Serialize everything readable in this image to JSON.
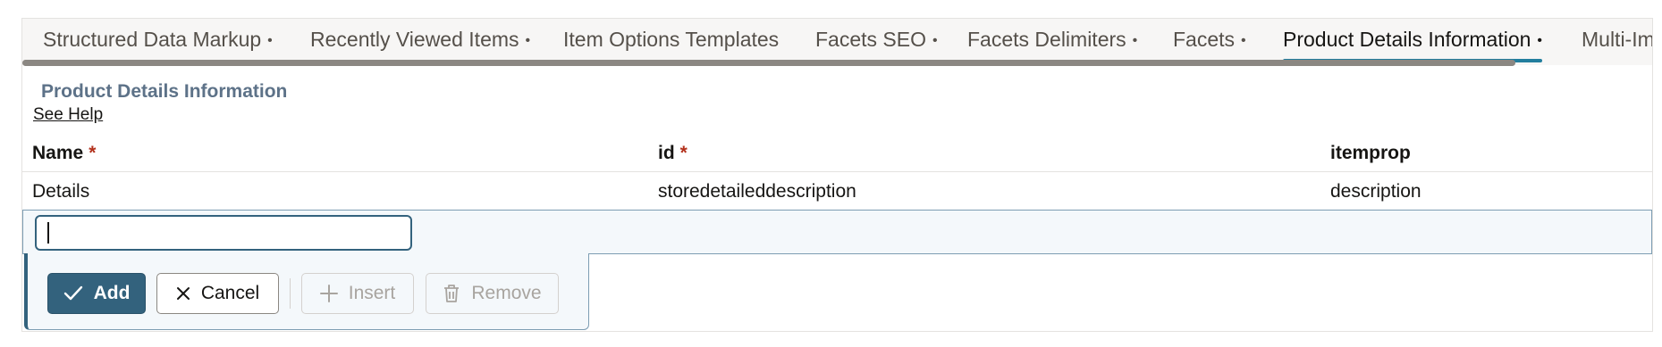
{
  "tabs": [
    {
      "label": "Structured Data Markup",
      "dot": "•",
      "active": false
    },
    {
      "label": "Recently Viewed Items",
      "dot": "•",
      "active": false
    },
    {
      "label": "Item Options Templates",
      "dot": "",
      "active": false
    },
    {
      "label": "Facets SEO",
      "dot": "•",
      "active": false
    },
    {
      "label": "Facets Delimiters",
      "dot": "•",
      "active": false
    },
    {
      "label": "Facets",
      "dot": "•",
      "active": false
    },
    {
      "label": "Product Details Information",
      "dot": "•",
      "active": true
    },
    {
      "label": "Multi-Im",
      "dot": "",
      "active": false
    }
  ],
  "section": {
    "title": "Product Details Information",
    "help_link": "See Help"
  },
  "table": {
    "columns": [
      {
        "label": "Name",
        "required": "*"
      },
      {
        "label": "id",
        "required": "*"
      },
      {
        "label": "itemprop",
        "required": ""
      }
    ],
    "rows": [
      {
        "name": "Details",
        "id": "storedetaileddescription",
        "itemprop": "description"
      }
    ]
  },
  "edit_row": {
    "name_value": "",
    "name_placeholder": ""
  },
  "toolbar": {
    "add_label": "Add",
    "cancel_label": "Cancel",
    "insert_label": "Insert",
    "remove_label": "Remove"
  },
  "colors": {
    "accent": "#33627d",
    "tab_indicator": "#227e9e",
    "title": "#5d7288",
    "required": "#b3311c",
    "disabled": "#a8a49f"
  }
}
